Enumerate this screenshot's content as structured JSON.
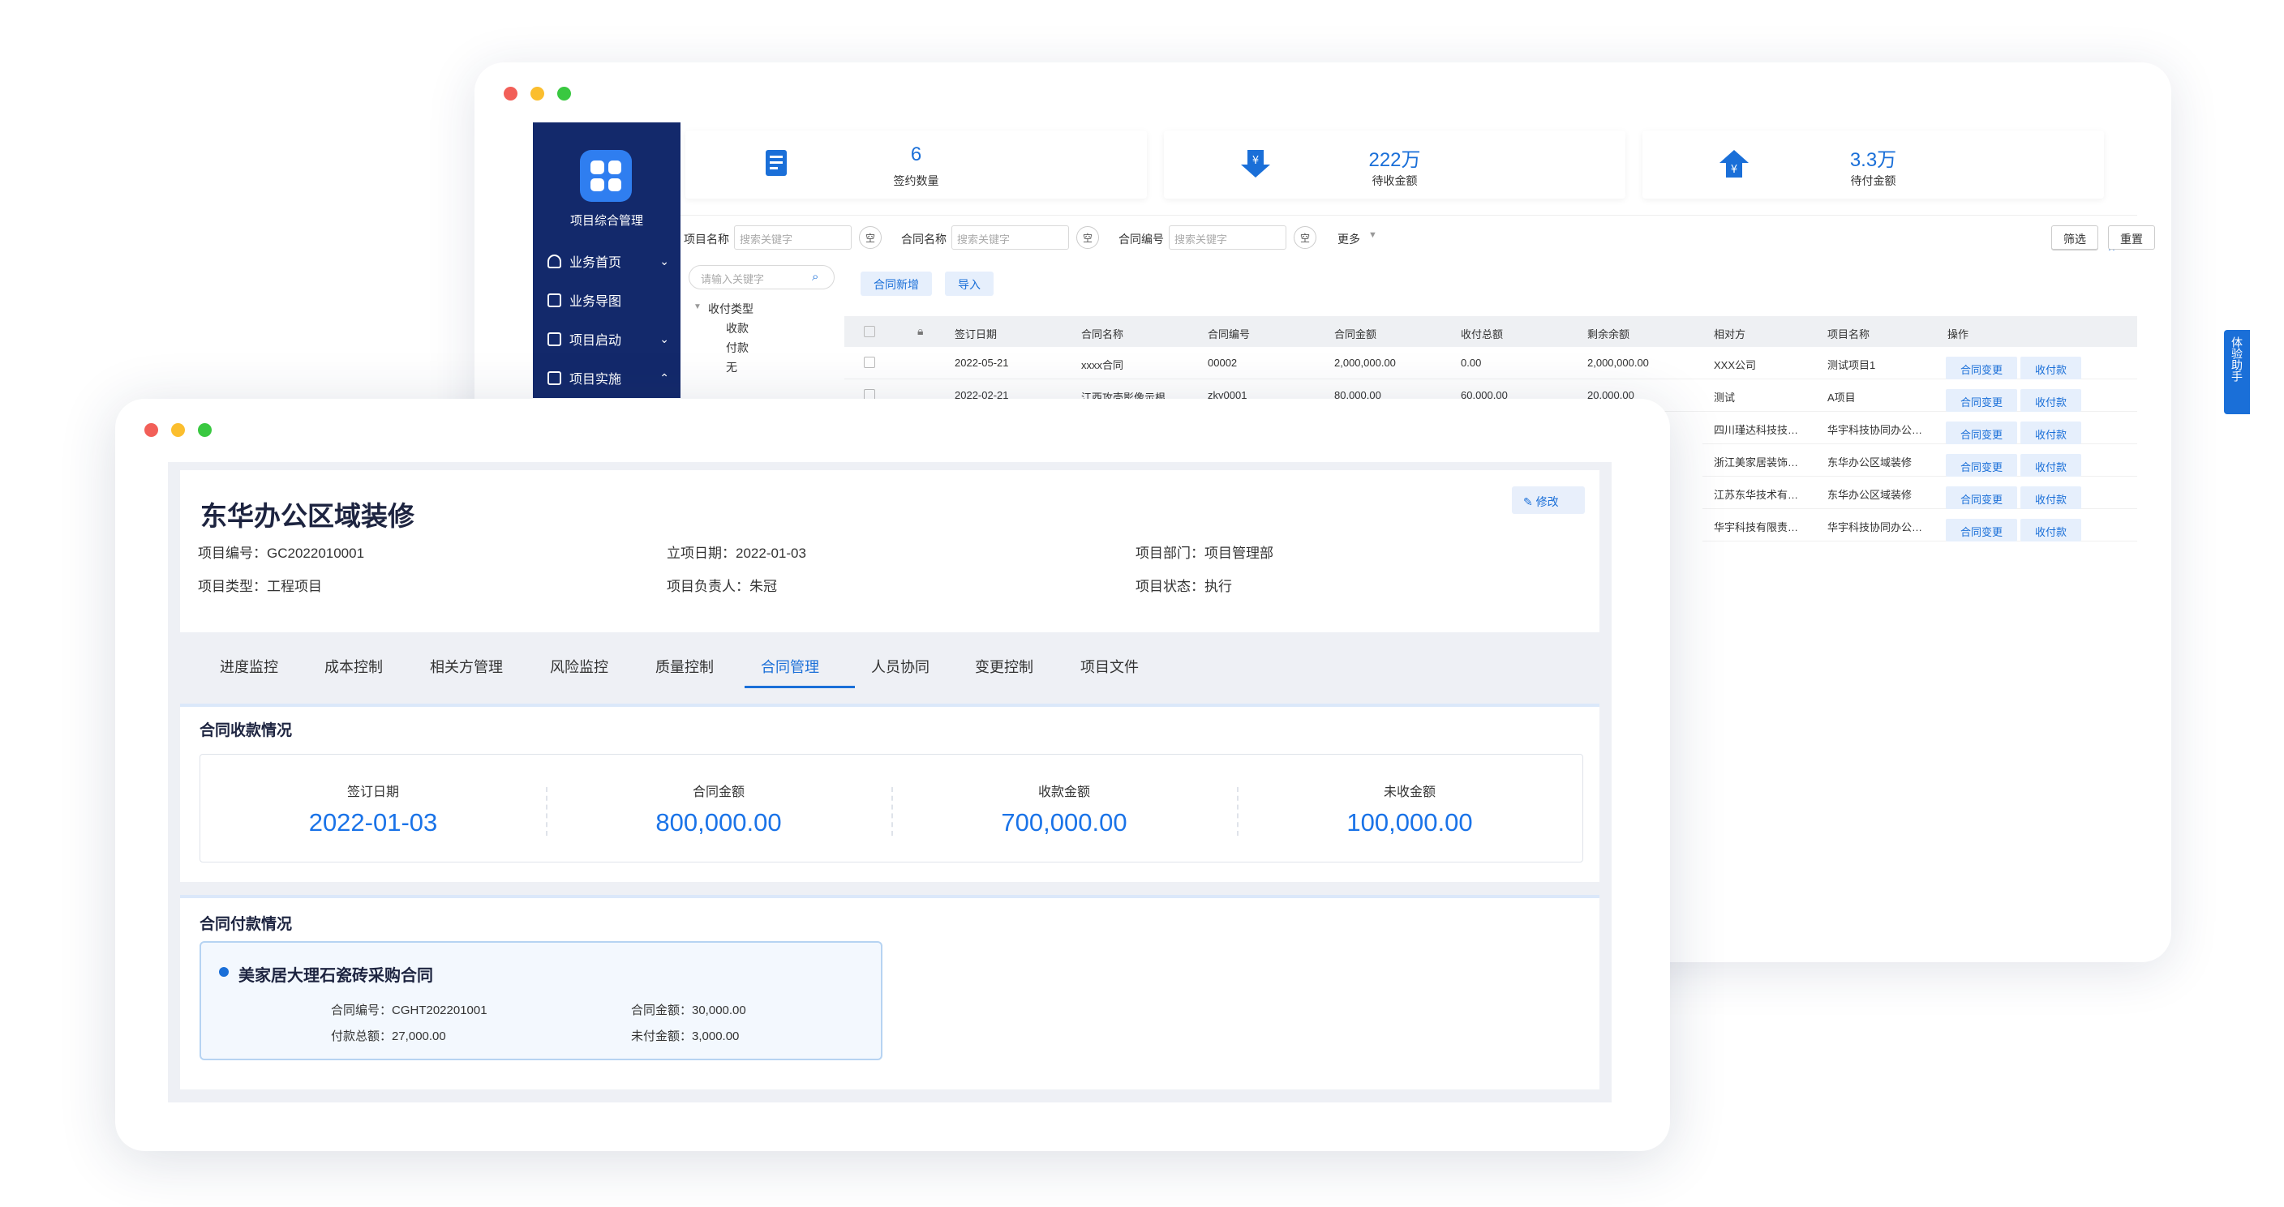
{
  "back_window": {
    "sidebar": {
      "title": "项目综合管理",
      "items": [
        {
          "label": "业务首页",
          "chevron": "⌄"
        },
        {
          "label": "业务导图",
          "chevron": ""
        },
        {
          "label": "项目启动",
          "chevron": "⌄"
        },
        {
          "label": "项目实施",
          "chevron": "⌃"
        }
      ]
    },
    "stats": [
      {
        "value": "6",
        "label": "签约数量",
        "icon": "contract-icon"
      },
      {
        "value": "222万",
        "label": "待收金额",
        "icon": "yuan-down-icon"
      },
      {
        "value": "3.3万",
        "label": "待付金额",
        "icon": "yuan-up-icon"
      }
    ],
    "filters": [
      {
        "label": "项目名称",
        "placeholder": "搜索关键字"
      },
      {
        "label": "合同名称",
        "placeholder": "搜索关键字"
      },
      {
        "label": "合同编号",
        "placeholder": "搜索关键字"
      }
    ],
    "clear_label": "空",
    "more_label": "更多",
    "filter_button": "筛选",
    "reset_button": "重置",
    "expand_icon": "»",
    "tree": {
      "search_placeholder": "请输入关键字",
      "root": "收付类型",
      "children": [
        "收款",
        "付款",
        "无"
      ]
    },
    "grid_buttons": {
      "add": "合同新增",
      "import": "导入"
    },
    "columns": [
      "签订日期",
      "合同名称",
      "合同编号",
      "合同金额",
      "收付总额",
      "剩余余额",
      "相对方",
      "项目名称",
      "操作"
    ],
    "rows": [
      [
        "2022-05-21",
        "xxxx合同",
        "00002",
        "2,000,000.00",
        "0.00",
        "2,000,000.00",
        "XXX公司",
        "测试项目1"
      ],
      [
        "2022-02-21",
        "江西攻壳影像示根",
        "zky0001",
        "80,000.00",
        "60,000.00",
        "20,000.00",
        "测试",
        "A项目"
      ],
      [
        "",
        "",
        "",
        "",
        "",
        "",
        "四川瑾达科技技…",
        "华宇科技协同办公…"
      ],
      [
        "",
        "",
        "",
        "",
        "",
        "",
        "浙江美家居装饰…",
        "东华办公区域装修"
      ],
      [
        "",
        "",
        "",
        "",
        "",
        "",
        "江苏东华技术有…",
        "东华办公区域装修"
      ],
      [
        "",
        "",
        "",
        "",
        "",
        "",
        "华宇科技有限责…",
        "华宇科技协同办公…"
      ]
    ],
    "row_actions": [
      "合同变更",
      "收付款"
    ],
    "helper_label": "体验助手"
  },
  "front_window": {
    "project": {
      "title": "东华办公区域装修",
      "edit_label": "修改",
      "fields": [
        "项目编号：GC2022010001",
        "立项日期：2022-01-03",
        "项目部门：项目管理部",
        "项目类型：工程项目",
        "项目负责人：朱冠",
        "项目状态：执行"
      ]
    },
    "tabs": [
      "进度监控",
      "成本控制",
      "相关方管理",
      "风险监控",
      "质量控制",
      "合同管理",
      "人员协同",
      "变更控制",
      "项目文件"
    ],
    "active_tab": "合同管理",
    "receipt": {
      "title": "合同收款情况",
      "items": [
        {
          "label": "签订日期",
          "value": "2022-01-03"
        },
        {
          "label": "合同金额",
          "value": "800,000.00"
        },
        {
          "label": "收款金额",
          "value": "700,000.00"
        },
        {
          "label": "未收金额",
          "value": "100,000.00"
        }
      ]
    },
    "payment": {
      "title": "合同付款情况",
      "card": {
        "name": "美家居大理石瓷砖采购合同",
        "fields": [
          "合同编号：CGHT202201001",
          "合同金额：30,000.00",
          "付款总额：27,000.00",
          "未付金额：3,000.00"
        ]
      }
    }
  },
  "colors": {
    "primary": "#1a6fd8",
    "sidebar": "#13296b",
    "value_blue": "#1a73e8",
    "panel_bg": "#eef0f5"
  }
}
